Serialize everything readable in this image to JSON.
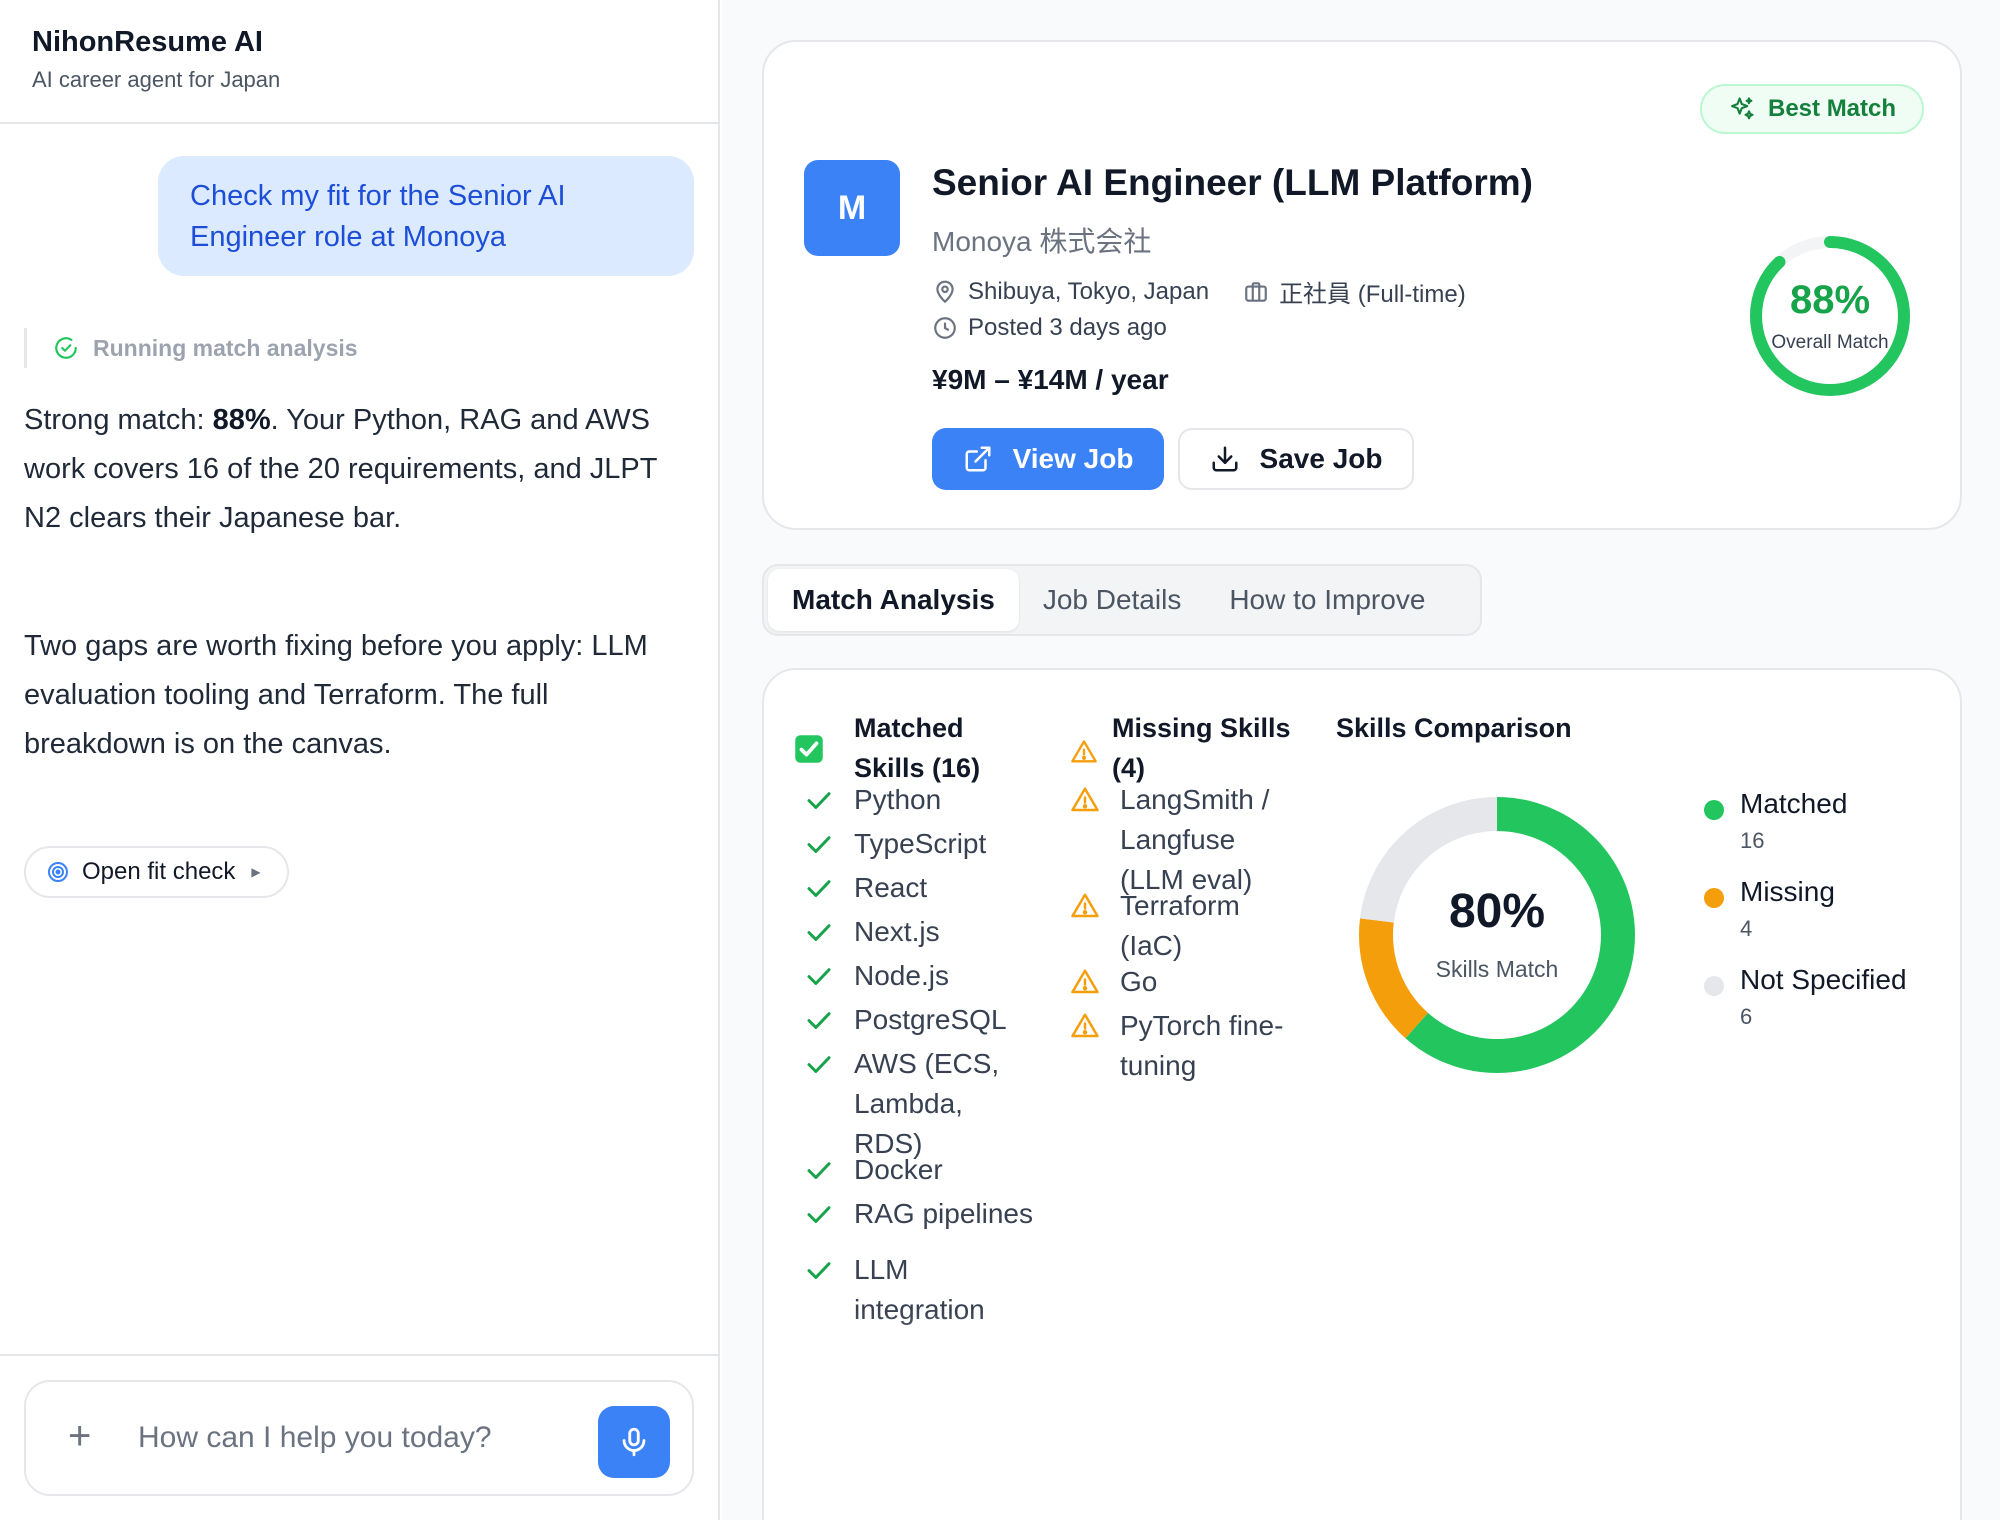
{
  "app": {
    "name": "NihonResume AI",
    "tagline": "AI career agent for Japan"
  },
  "chat": {
    "user_message": "Check my fit for the Senior AI Engineer role at Monoya",
    "status": "Running match analysis",
    "reply_1": {
      "pre": "Strong match: ",
      "bold": "88%",
      "post": ". Your Python, RAG and AWS work covers 16 of the 20 requirements, and JLPT N2 clears their Japanese bar."
    },
    "reply_2": "Two gaps are worth fixing before you apply: LLM evaluation tooling and Terraform. The full breakdown is on the canvas.",
    "open_button": "Open fit check",
    "composer_placeholder": "How can I help you today?"
  },
  "job": {
    "badge": "Best Match",
    "logo_letter": "M",
    "title": "Senior AI Engineer (LLM Platform)",
    "company": "Monoya 株式会社",
    "location": "Shibuya, Tokyo, Japan",
    "employment": "正社員 (Full-time)",
    "posted": "Posted 3 days ago",
    "salary": "¥9M – ¥14M / year",
    "view_button": "View Job",
    "save_button": "Save Job",
    "overall_match": {
      "value": 88,
      "label_pct": "88%",
      "label": "Overall Match"
    }
  },
  "tabs": [
    {
      "label": "Match Analysis",
      "active": true
    },
    {
      "label": "Job Details",
      "active": false
    },
    {
      "label": "How to Improve",
      "active": false
    }
  ],
  "analysis": {
    "matched_heading": "Matched Skills (16)",
    "missing_heading": "Missing Skills (4)",
    "comparison_heading": "Skills Comparison",
    "matched": [
      "Python",
      "TypeScript",
      "React",
      "Next.js",
      "Node.js",
      "PostgreSQL",
      "AWS (ECS, Lambda, RDS)",
      "Docker",
      "RAG pipelines",
      "LLM integration"
    ],
    "missing": [
      "LangSmith / Langfuse (LLM eval)",
      "Terraform (IaC)",
      "Go",
      "PyTorch fine-tuning"
    ],
    "donut_center": "80%",
    "donut_label": "Skills Match"
  },
  "chart_data": {
    "type": "pie",
    "title": "Skills Comparison",
    "categories": [
      "Matched",
      "Missing",
      "Not Specified"
    ],
    "values": [
      16,
      4,
      6
    ],
    "center_label": "80%",
    "center_sublabel": "Skills Match",
    "legend": "right",
    "colors": [
      "#22c55e",
      "#f59e0b",
      "#e5e7eb"
    ]
  },
  "colors": {
    "accent": "#3b82f6",
    "match_green": "#22c55e",
    "missing_orange": "#f59e0b",
    "unspecified_gray": "#e5e7eb"
  },
  "icons": {
    "status": "check-circle-icon",
    "open": "target-icon",
    "composer_add": "plus-icon",
    "composer_mic": "microphone-icon",
    "badge": "sparkles-icon",
    "location": "map-pin-icon",
    "employment": "briefcase-icon",
    "posted": "clock-icon",
    "view": "external-link-icon",
    "save": "download-icon",
    "matched_item": "check-icon",
    "missing_item": "warning-icon"
  }
}
